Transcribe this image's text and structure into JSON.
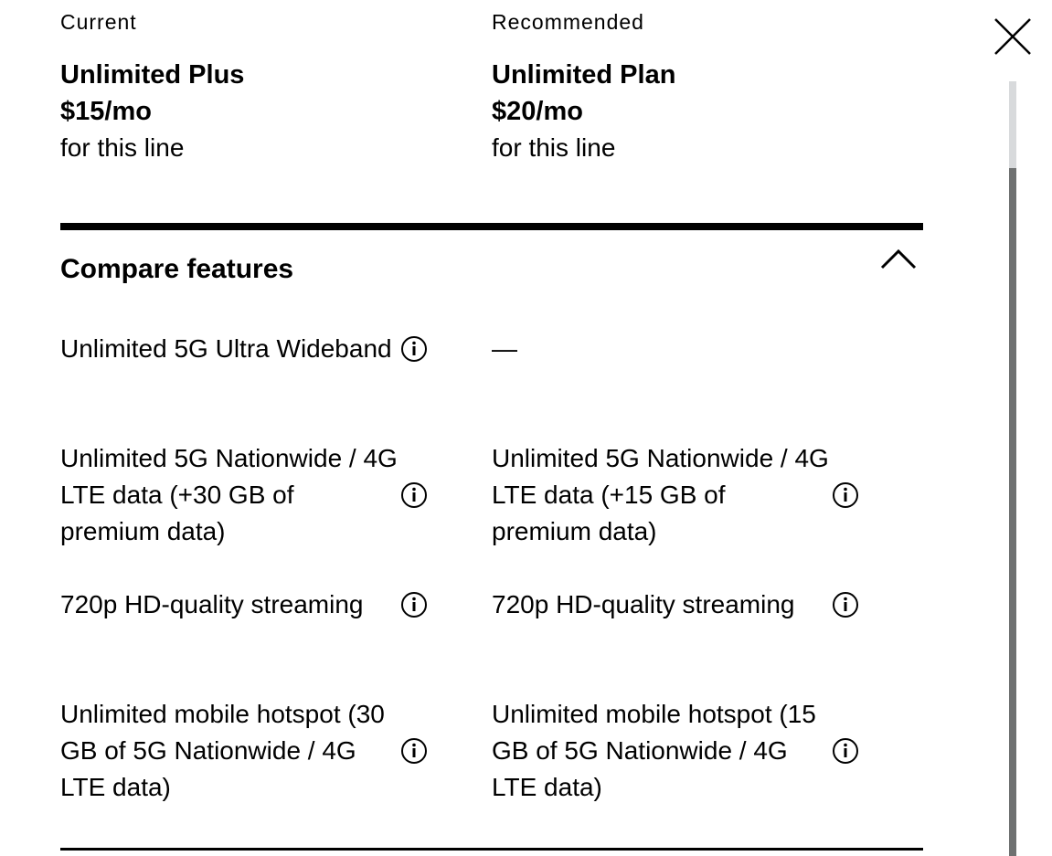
{
  "plans": {
    "current": {
      "label": "Current",
      "name": "Unlimited Plus",
      "price": "$15/mo",
      "subtext": "for this line"
    },
    "recommended": {
      "label": "Recommended",
      "name": "Unlimited Plan",
      "price": "$20/mo",
      "subtext": "for this line"
    }
  },
  "close": {
    "icon": "close-icon"
  },
  "compare": {
    "title": "Compare features",
    "toggle_icon": "chevron-up-icon",
    "expanded": true
  },
  "features": [
    {
      "current": "Unlimited 5G Ultra Wideband",
      "recommended": "—",
      "current_info": true,
      "recommended_info": false
    },
    {
      "current": "Unlimited 5G Nationwide / 4G LTE data (+30 GB of premium data)",
      "recommended": "Unlimited 5G Nationwide / 4G LTE data (+15 GB of premium data)",
      "current_info": true,
      "recommended_info": true
    },
    {
      "current": "720p HD-quality streaming",
      "recommended": "720p HD-quality streaming",
      "current_info": true,
      "recommended_info": true
    },
    {
      "current": "Unlimited mobile hotspot (30 GB of 5G Nationwide / 4G LTE data)",
      "recommended": "Unlimited mobile hotspot (15 GB of 5G Nationwide / 4G LTE data)",
      "current_info": true,
      "recommended_info": true
    }
  ],
  "colors": {
    "text": "#000000",
    "scroll_track": "#d8dadc",
    "scroll_thumb": "#6f7171"
  }
}
